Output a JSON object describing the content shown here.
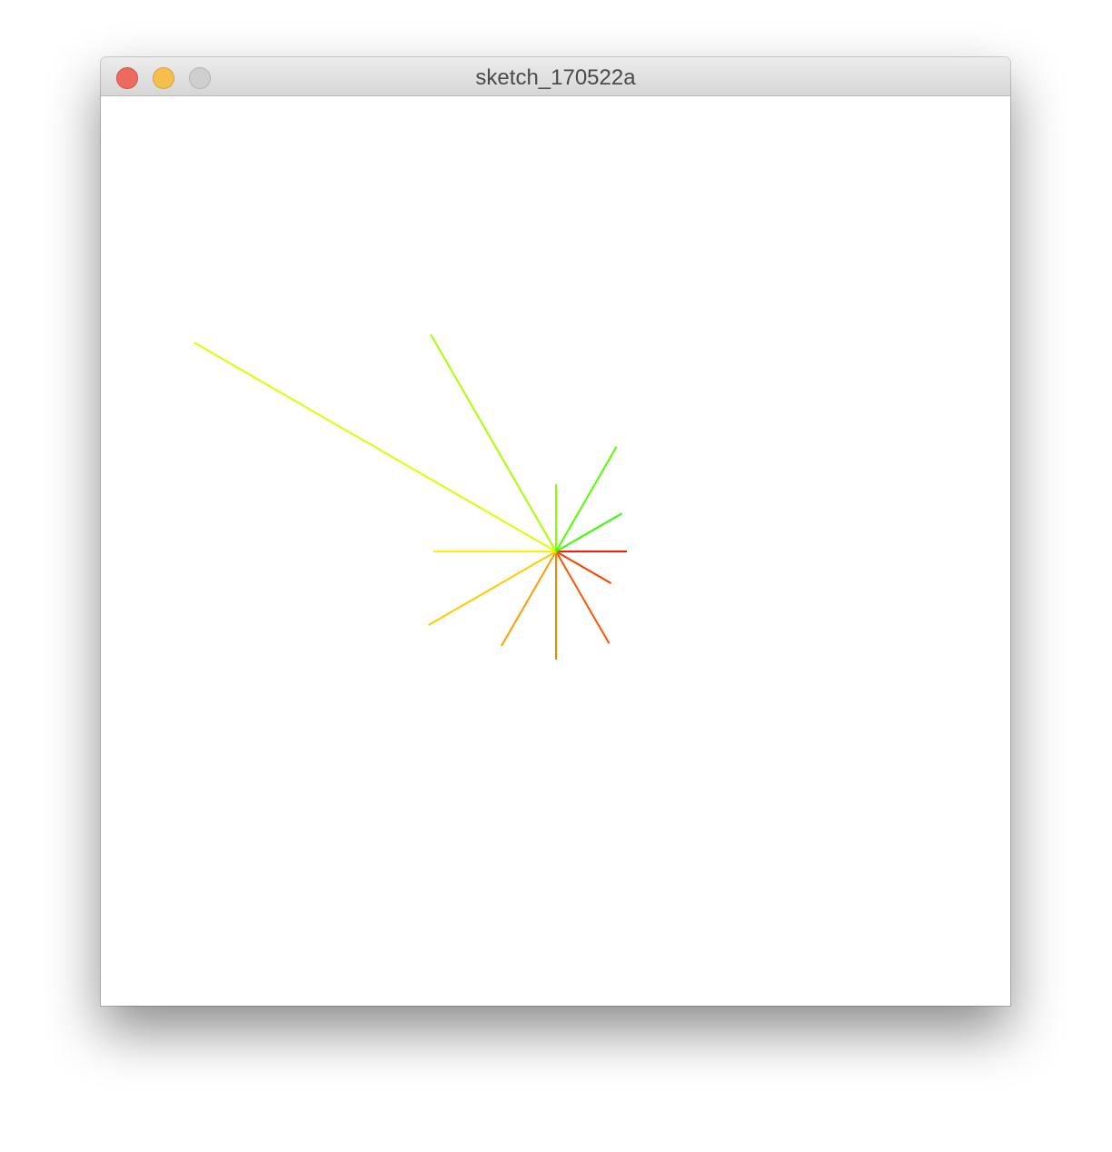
{
  "window": {
    "title": "sketch_170522a",
    "controls": {
      "close_color": "#ed6a5e",
      "minimize_color": "#f5bf4f",
      "zoom_color": "#cfcfcf"
    }
  },
  "sketch": {
    "background": "#ffffff",
    "rays": [
      {
        "angle_deg": 0,
        "length": 78,
        "color": "#ff1a00"
      },
      {
        "angle_deg": 30,
        "length": 70,
        "color": "#ff3b00"
      },
      {
        "angle_deg": 60,
        "length": 117,
        "color": "#ff5500"
      },
      {
        "angle_deg": 90,
        "length": 119,
        "color": "#ff7f00"
      },
      {
        "angle_deg": 120,
        "length": 120,
        "color": "#ff9e00"
      },
      {
        "angle_deg": 150,
        "length": 162,
        "color": "#ffcc00"
      },
      {
        "angle_deg": 180,
        "length": 135,
        "color": "#fff000"
      },
      {
        "angle_deg": 210,
        "length": 460,
        "color": "#ddff00"
      },
      {
        "angle_deg": 240,
        "length": 276,
        "color": "#aaff00"
      },
      {
        "angle_deg": 270,
        "length": 74,
        "color": "#7fff00"
      },
      {
        "angle_deg": 300,
        "length": 133,
        "color": "#55ff00"
      },
      {
        "angle_deg": 330,
        "length": 84,
        "color": "#33ff00"
      }
    ]
  }
}
